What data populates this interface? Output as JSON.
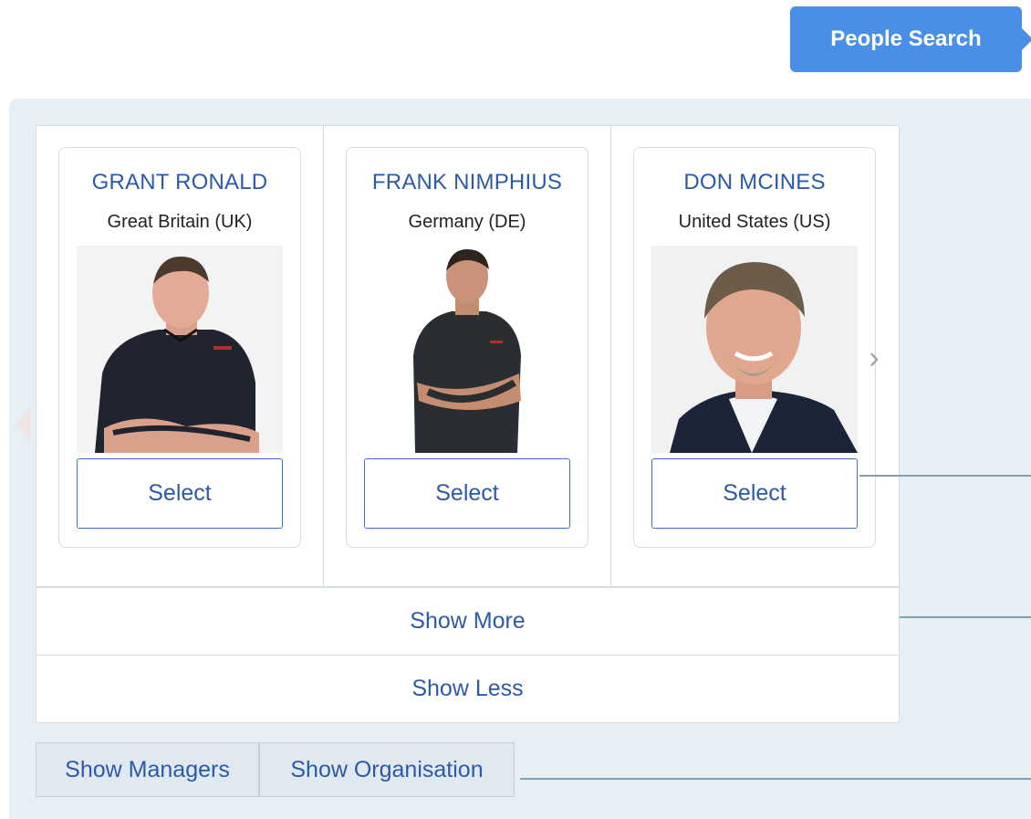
{
  "header": {
    "callout_label": "People Search"
  },
  "carousel": {
    "people": [
      {
        "name": "GRANT RONALD",
        "country": "Great Britain (UK)",
        "select_label": "Select"
      },
      {
        "name": "FRANK NIMPHIUS",
        "country": "Germany (DE)",
        "select_label": "Select"
      },
      {
        "name": "DON MCINES",
        "country": "United States (US)",
        "select_label": "Select"
      }
    ],
    "next_icon": "chevron-right-icon",
    "prev_icon": "chevron-left-icon"
  },
  "actions": {
    "show_more_label": "Show More",
    "show_less_label": "Show Less",
    "show_managers_label": "Show Managers",
    "show_organisation_label": "Show Organisation"
  },
  "colors": {
    "accent": "#4a8fe7",
    "link_text": "#2c5aa8",
    "panel_bg": "#e6eff6"
  }
}
